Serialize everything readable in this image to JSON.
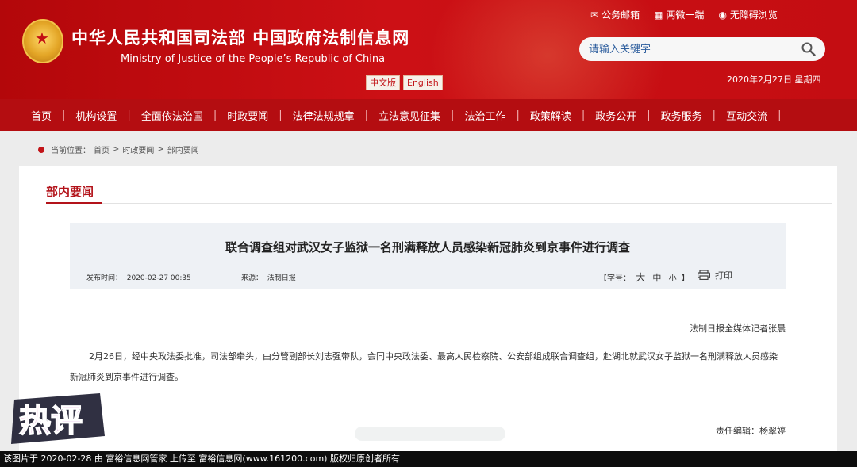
{
  "header": {
    "title": "中华人民共和国司法部  中国政府法制信息网",
    "subtitle": "Ministry of Justice of the People’s Republic of China",
    "lang_cn": "中文版",
    "lang_en": "English",
    "links": [
      {
        "label": "公务邮箱",
        "icon": "mail-icon"
      },
      {
        "label": "两微一端",
        "icon": "grid-icon"
      },
      {
        "label": "无障碍浏览",
        "icon": "eye-icon"
      }
    ],
    "search_placeholder": "请输入关键字",
    "date": "2020年2月27日 星期四"
  },
  "nav": {
    "items": [
      "首页",
      "机构设置",
      "全面依法治国",
      "时政要闻",
      "法律法规规章",
      "立法意见征集",
      "法治工作",
      "政策解读",
      "政务公开",
      "政务服务",
      "互动交流"
    ]
  },
  "breadcrumb": {
    "prefix": "当前位置：",
    "items": [
      "首页",
      "时政要闻",
      "部内要闻"
    ],
    "sep": ">"
  },
  "section": {
    "title": "部内要闻"
  },
  "article": {
    "title": "联合调查组对武汉女子监狱一名刑满释放人员感染新冠肺炎到京事件进行调查",
    "publish_label": "发布时间：",
    "publish_time": "2020-02-27 00:35",
    "source_label": "来源：",
    "source": "法制日报",
    "fontsize_label": "【字号：",
    "fontsize_options": [
      "大",
      "中",
      "小"
    ],
    "fontsize_close": "】",
    "print_label": "打印",
    "reporter": "法制日报全媒体记者张晨",
    "body": "2月26日，经中央政法委批准，司法部牵头，由分管副部长刘志强带队，会同中央政法委、最高人民检察院、公安部组成联合调查组，赴湖北就武汉女子监狱一名刑满释放人员感染新冠肺炎到京事件进行调查。",
    "editor": "责任编辑：杨翠婷"
  },
  "overlay": {
    "hot_logo_text": "热评",
    "watermark": "该图片于 2020-02-28 由 富裕信息网管家 上传至 富裕信息网(www.161200.com) 版权归原创者所有"
  },
  "colors": {
    "brand_red": "#c40d12",
    "nav_red": "#b40d11",
    "accent_text": "#b3131a"
  }
}
